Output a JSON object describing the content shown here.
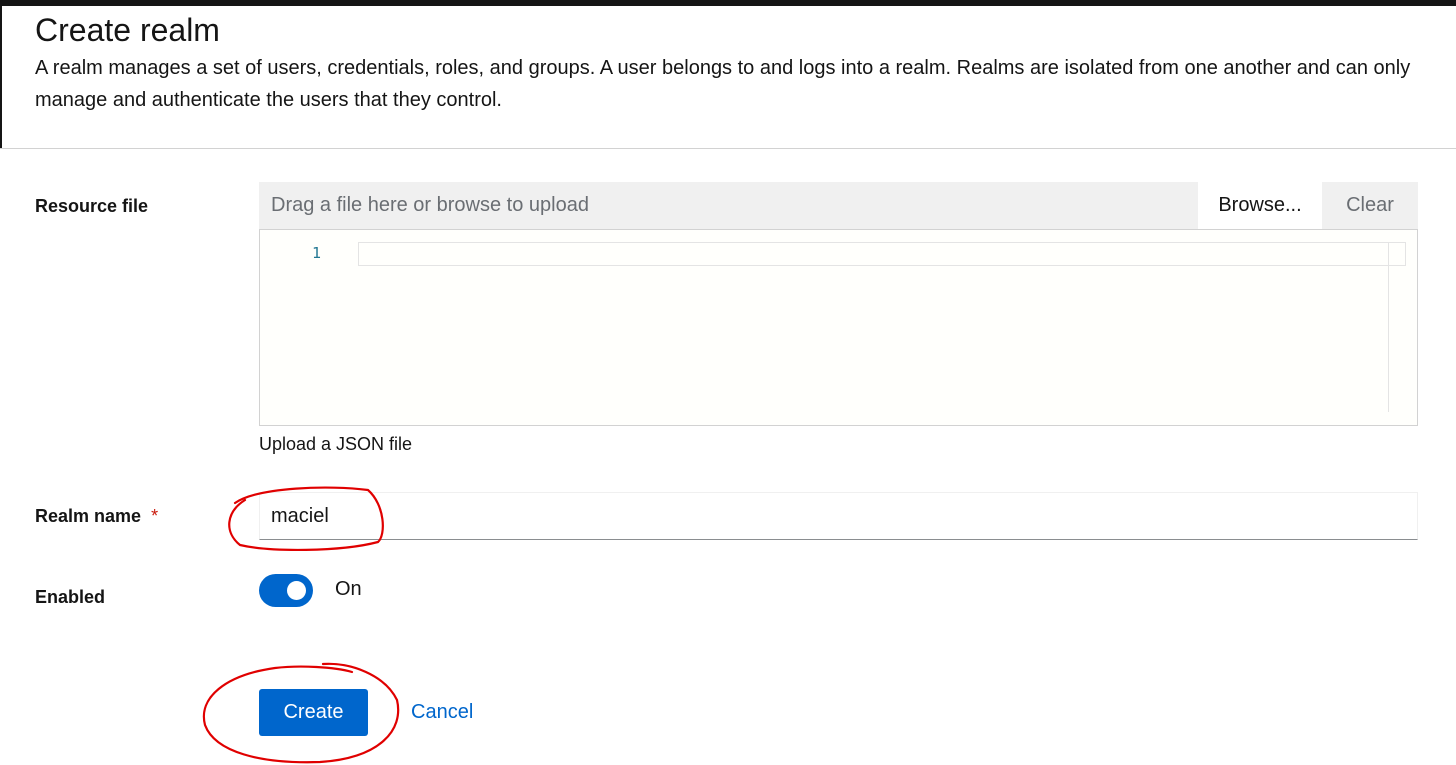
{
  "page": {
    "title": "Create realm",
    "description": "A realm manages a set of users, credentials, roles, and groups. A user belongs to and logs into a realm. Realms are isolated from one another and can only manage and authenticate the users that they control."
  },
  "form": {
    "resource_file": {
      "label": "Resource file",
      "placeholder": "Drag a file here or browse to upload",
      "browse_label": "Browse...",
      "clear_label": "Clear",
      "editor_line_number": "1",
      "helper_text": "Upload a JSON file"
    },
    "realm_name": {
      "label": "Realm name",
      "required_marker": "*",
      "value": "maciel"
    },
    "enabled": {
      "label": "Enabled",
      "state_text": "On",
      "checked": true
    }
  },
  "actions": {
    "create_label": "Create",
    "cancel_label": "Cancel"
  },
  "colors": {
    "primary": "#0066cc",
    "required": "#c9190b",
    "annotation": "#e00000"
  }
}
